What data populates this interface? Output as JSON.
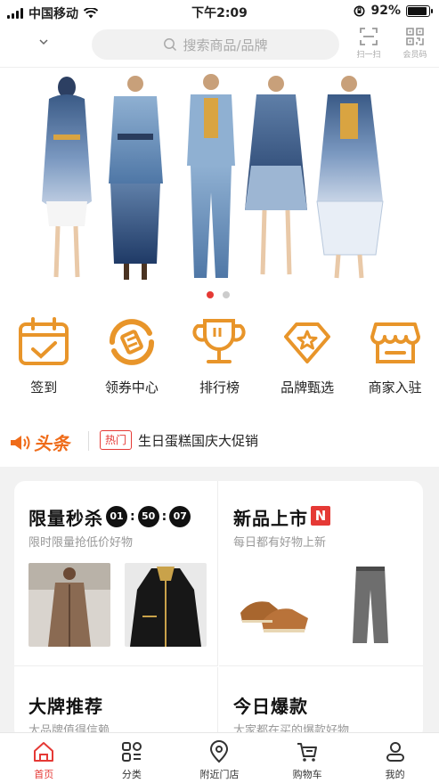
{
  "status_bar": {
    "carrier": "中国移动",
    "time": "下午2:09",
    "battery": "92%",
    "battery_level": 0.92
  },
  "header": {
    "search_placeholder": "搜索商品/品牌",
    "scan_label": "扫一扫",
    "member_code_label": "会员码"
  },
  "banner": {
    "slide_count": 2,
    "active_index": 0
  },
  "quick_nav": [
    {
      "label": "签到",
      "icon": "calendar-check-icon"
    },
    {
      "label": "领券中心",
      "icon": "coupon-icon"
    },
    {
      "label": "排行榜",
      "icon": "trophy-icon"
    },
    {
      "label": "品牌甄选",
      "icon": "diamond-star-icon"
    },
    {
      "label": "商家入驻",
      "icon": "storefront-icon"
    }
  ],
  "headline": {
    "logo": "头条",
    "tag": "热门",
    "text": "生日蛋糕国庆大促销"
  },
  "cards": {
    "flash_sale": {
      "title": "限量秒杀",
      "subtitle": "限时限量抢低价好物",
      "countdown": [
        "01",
        "50",
        "07"
      ]
    },
    "new_arrivals": {
      "title": "新品上市",
      "badge": "N",
      "subtitle": "每日都有好物上新"
    },
    "brands": {
      "title": "大牌推荐",
      "subtitle": "大品牌值得信赖"
    },
    "hot_today": {
      "title": "今日爆款",
      "subtitle": "大家都在买的爆款好物"
    }
  },
  "tabbar": [
    {
      "label": "首页",
      "icon": "home-icon",
      "active": true
    },
    {
      "label": "分类",
      "icon": "category-icon",
      "active": false
    },
    {
      "label": "附近门店",
      "icon": "location-pin-icon",
      "active": false
    },
    {
      "label": "购物车",
      "icon": "cart-icon",
      "active": false
    },
    {
      "label": "我的",
      "icon": "user-icon",
      "active": false
    }
  ],
  "colors": {
    "accent": "#e53935",
    "icon_orange": "#e8952a",
    "headline_orange": "#ef6c1a"
  }
}
